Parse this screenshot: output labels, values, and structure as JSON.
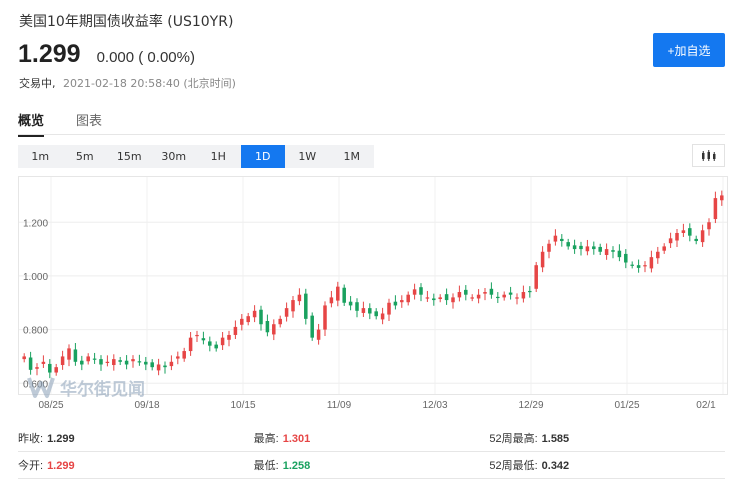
{
  "header": {
    "title": "美国10年期国债收益率 (US10YR)",
    "price": "1.299",
    "change": "0.000 ( 0.00%)",
    "status": "交易中,",
    "timestamp": "2021-02-18 20:58:40 (北京时间)",
    "watch_label": "+加自选"
  },
  "tabs": [
    {
      "label": "概览",
      "active": true
    },
    {
      "label": "图表",
      "active": false
    }
  ],
  "periods": [
    {
      "label": "1m",
      "active": false
    },
    {
      "label": "5m",
      "active": false
    },
    {
      "label": "15m",
      "active": false
    },
    {
      "label": "30m",
      "active": false
    },
    {
      "label": "1H",
      "active": false
    },
    {
      "label": "1D",
      "active": true
    },
    {
      "label": "1W",
      "active": false
    },
    {
      "label": "1M",
      "active": false
    }
  ],
  "colors": {
    "accent": "#1478f0",
    "up": "#e64545",
    "down": "#19a15f"
  },
  "watermark": {
    "text": "华尔街见闻",
    "icon": "wallstreetcn-logo-icon"
  },
  "chart_data": {
    "type": "candlestick",
    "y_ticks": [
      "0.600",
      "0.800",
      "1.000",
      "1.200"
    ],
    "ylim": [
      0.56,
      1.35
    ],
    "x_ticks": [
      "08/25",
      "09/18",
      "10/15",
      "11/09",
      "12/03",
      "12/29",
      "01/25",
      "02/1"
    ],
    "levels": [
      0.7,
      0.65,
      0.66,
      0.68,
      0.64,
      0.66,
      0.7,
      0.73,
      0.68,
      0.67,
      0.7,
      0.69,
      0.67,
      0.68,
      0.69,
      0.68,
      0.67,
      0.69,
      0.68,
      0.67,
      0.66,
      0.67,
      0.66,
      0.68,
      0.7,
      0.72,
      0.77,
      0.78,
      0.76,
      0.74,
      0.73,
      0.77,
      0.78,
      0.81,
      0.84,
      0.85,
      0.87,
      0.82,
      0.79,
      0.82,
      0.84,
      0.88,
      0.91,
      0.93,
      0.84,
      0.77,
      0.8,
      0.89,
      0.92,
      0.96,
      0.9,
      0.89,
      0.87,
      0.88,
      0.86,
      0.85,
      0.86,
      0.9,
      0.89,
      0.91,
      0.93,
      0.95,
      0.93,
      0.92,
      0.91,
      0.92,
      0.91,
      0.92,
      0.94,
      0.93,
      0.92,
      0.93,
      0.94,
      0.93,
      0.92,
      0.93,
      0.93,
      0.92,
      0.94,
      0.94,
      1.04,
      1.09,
      1.12,
      1.15,
      1.13,
      1.11,
      1.1,
      1.1,
      1.11,
      1.1,
      1.09,
      1.1,
      1.09,
      1.07,
      1.05,
      1.04,
      1.03,
      1.04,
      1.07,
      1.09,
      1.11,
      1.14,
      1.16,
      1.17,
      1.15,
      1.13,
      1.17,
      1.2,
      1.29,
      1.3
    ]
  },
  "stats": [
    [
      {
        "label": "昨收:",
        "value": "1.299",
        "tone": ""
      },
      {
        "label": "最高:",
        "value": "1.301",
        "tone": "red"
      },
      {
        "label": "52周最高:",
        "value": "1.585",
        "tone": ""
      }
    ],
    [
      {
        "label": "今开:",
        "value": "1.299",
        "tone": "red"
      },
      {
        "label": "最低:",
        "value": "1.258",
        "tone": "green"
      },
      {
        "label": "52周最低:",
        "value": "0.342",
        "tone": ""
      }
    ]
  ]
}
